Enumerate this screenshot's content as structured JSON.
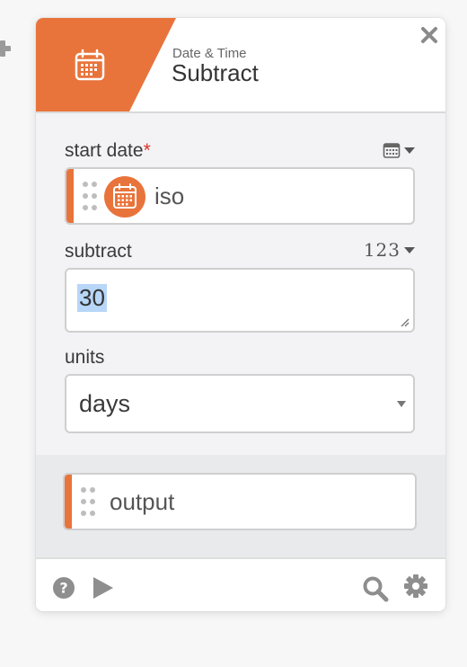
{
  "header": {
    "subtitle": "Date & Time",
    "title": "Subtract",
    "icon": "calendar-icon",
    "accent_color": "#e8743b"
  },
  "fields": {
    "start_date": {
      "label": "start date",
      "required_mark": "*",
      "type_icon": "calendar-icon",
      "value": "iso"
    },
    "subtract": {
      "label": "subtract",
      "type_label": "123",
      "value": "30"
    },
    "units": {
      "label": "units",
      "selected": "days"
    }
  },
  "output": {
    "label": "output"
  },
  "footer": {
    "left_icons": [
      "help-icon",
      "play-icon"
    ],
    "right_icons": [
      "search-icon",
      "gear-icon"
    ]
  }
}
